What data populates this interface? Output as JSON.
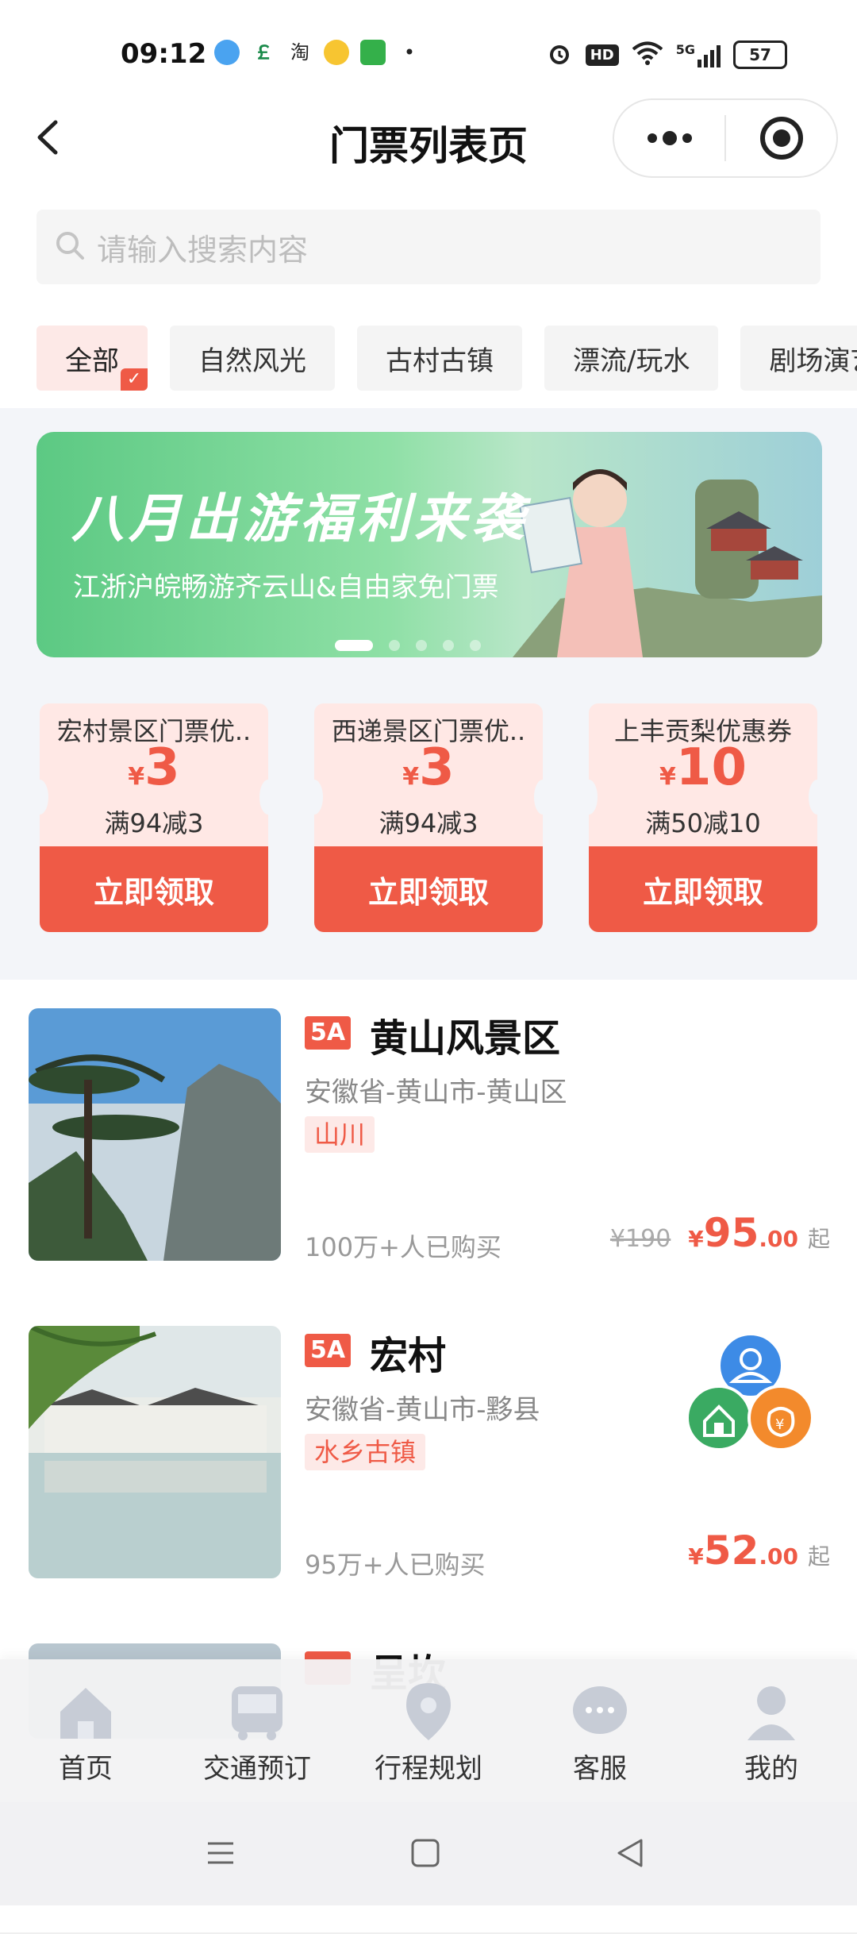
{
  "status_bar": {
    "time": "09:12",
    "network": "5G",
    "battery": "57"
  },
  "header": {
    "title": "门票列表页"
  },
  "search": {
    "placeholder": "请输入搜索内容"
  },
  "categories": [
    "全部",
    "自然风光",
    "古村古镇",
    "漂流/玩水",
    "剧场演艺"
  ],
  "banner": {
    "headline": "八月出游福利来袭",
    "subline": "江浙沪皖畅游齐云山&自由家免门票"
  },
  "coupons": [
    {
      "name": "宏村景区门票优..",
      "currency": "¥",
      "amount": "3",
      "condition": "满94减3",
      "button": "立即领取"
    },
    {
      "name": "西递景区门票优..",
      "currency": "¥",
      "amount": "3",
      "condition": "满94减3",
      "button": "立即领取"
    },
    {
      "name": "上丰贡梨优惠券",
      "currency": "¥",
      "amount": "10",
      "condition": "满50减10",
      "button": "立即领取"
    }
  ],
  "items": [
    {
      "badge": "5A",
      "name": "黄山风景区",
      "address": "安徽省-黄山市-黄山区",
      "tag": "山川",
      "sales": "100万+人已购买",
      "orig_price": "¥190",
      "currency": "¥",
      "price_int": "95",
      "price_dec": ".00",
      "suffix": "起"
    },
    {
      "badge": "5A",
      "name": "宏村",
      "address": "安徽省-黄山市-黟县",
      "tag": "水乡古镇",
      "sales": "95万+人已购买",
      "currency": "¥",
      "price_int": "52",
      "price_dec": ".00",
      "suffix": "起"
    },
    {
      "badge": "",
      "name": "呈坎"
    }
  ],
  "tabbar": [
    "首页",
    "交通预订",
    "行程规划",
    "客服",
    "我的"
  ],
  "colors": {
    "accent": "#ef5a46",
    "tag_bg": "#fde9e7",
    "banner_green": "#5cc983"
  }
}
